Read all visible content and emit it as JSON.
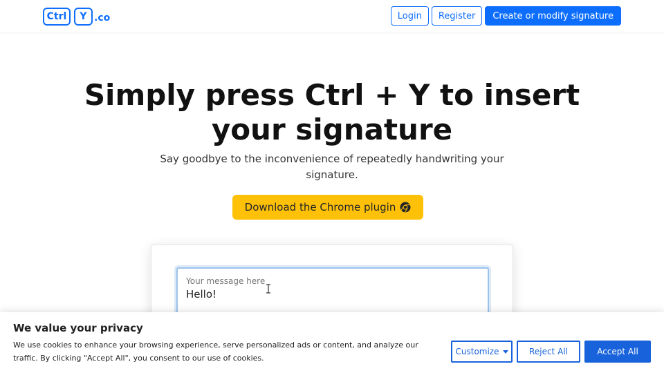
{
  "nav": {
    "logo_ctrl": "Ctrl",
    "logo_y": "Y",
    "logo_tld": ".co",
    "login_label": "Login",
    "register_label": "Register",
    "create_label": "Create or modify signature"
  },
  "hero": {
    "title_line1": "Simply press Ctrl + Y to insert",
    "title_line2": "your signature",
    "subtitle_line1": "Say goodbye to the inconvenience of repeatedly handwriting your",
    "subtitle_line2": "signature.",
    "download_label": "Download the Chrome plugin",
    "download_icon": "chrome-icon"
  },
  "preview": {
    "placeholder": "Your message here",
    "message": "Hello!"
  },
  "cookie": {
    "title": "We value your privacy",
    "text": "We use cookies to enhance your browsing experience, serve personalized ads or content, and analyze our traffic. By clicking \"Accept All\", you consent to our use of cookies.",
    "customize_label": "Customize",
    "reject_label": "Reject All",
    "accept_label": "Accept All"
  },
  "colors": {
    "primary": "#0d6efd",
    "cta_yellow": "#ffc107",
    "cookie_blue": "#1863dc"
  }
}
